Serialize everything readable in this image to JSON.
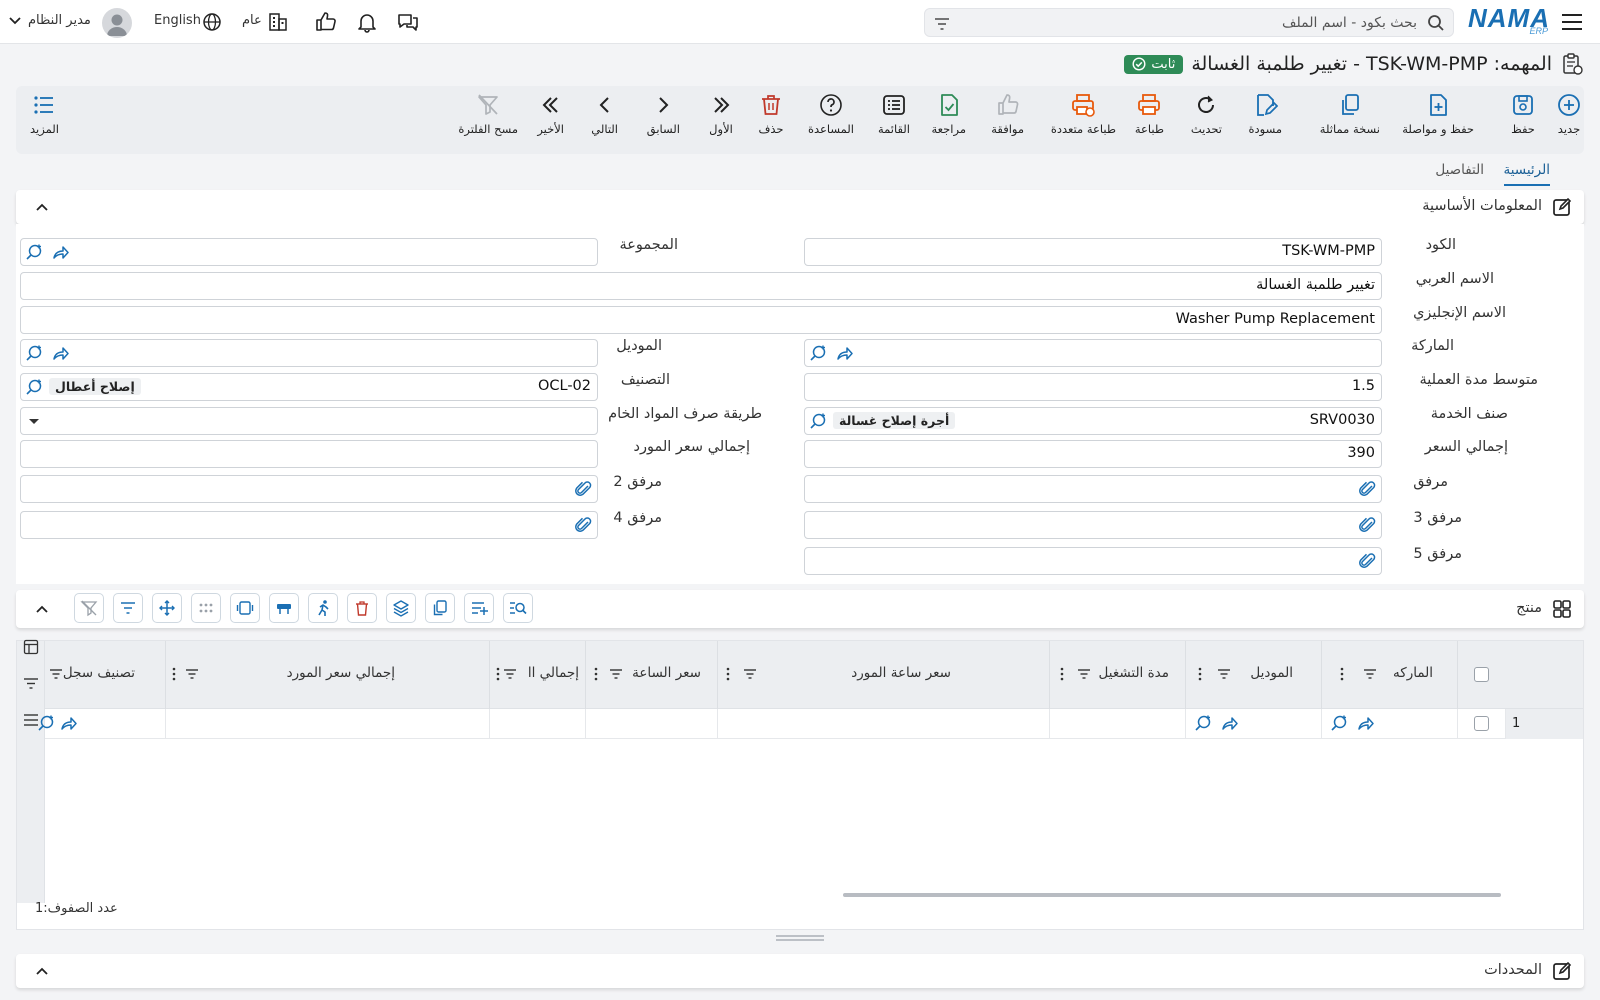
{
  "topbar": {
    "search_placeholder": "بحث بكود - اسم الملف",
    "language": "English",
    "branch": "عام",
    "user": "مدير النظام"
  },
  "title": {
    "text": "المهمه: TSK-WM-PMP - تغيير طلمبة الغسالة",
    "status": "ثابت",
    "status_color": "#2e8b57"
  },
  "actions": {
    "new": "جديد",
    "save": "حفظ",
    "save_continue": "حفظ و مواصلة",
    "duplicate": "نسخة مماثلة",
    "draft": "مسودة",
    "refresh": "تحديث",
    "print": "طباعة",
    "multi_print": "طباعة متعددة",
    "approve": "موافقة",
    "review": "مراجعة",
    "list": "القائمة",
    "help": "المساعدة",
    "delete": "حذف",
    "first": "الأول",
    "previous": "السابق",
    "next": "التالي",
    "last": "الأخير",
    "clear_filter": "مسح الفلترة",
    "more": "المزيد"
  },
  "tabs": {
    "main": "الرئيسية",
    "details": "التفاصيل"
  },
  "basic_info": {
    "title": "المعلومات الأساسية",
    "code_label": "الكود",
    "code_value": "TSK-WM-PMP",
    "group_label": "المجموعة",
    "arabic_name_label": "الاسم العربي",
    "arabic_name_value": "تغيير طلمبة الغسالة",
    "english_name_label": "الاسم الإنجليزي",
    "english_name_value": "Washer Pump Replacement",
    "brand_label": "الماركة",
    "model_label": "الموديل",
    "avg_duration_label": "متوسط مدة العملية",
    "avg_duration_value": "1.5",
    "category_label": "التصنيف",
    "category_code": "OCL-02",
    "category_name": "إصلاح أعطال",
    "service_item_label": "صنف الخدمة",
    "service_item_code": "SRV0030",
    "service_item_name": "أجرة إصلاح غسالة",
    "raw_material_label": "طريقة صرف المواد الخام",
    "total_price_label": "إجمالي السعر",
    "total_price_value": "390",
    "total_supplier_price_label": "إجمالي سعر المورد",
    "attachment_label": "مرفق",
    "attachment2_label": "مرفق 2",
    "attachment3_label": "مرفق 3",
    "attachment4_label": "مرفق 4",
    "attachment5_label": "مرفق 5"
  },
  "products": {
    "title": "منتج",
    "columns": {
      "brand": "الماركه",
      "model": "الموديل",
      "run_duration": "مدة التشغيل",
      "supplier_hour_price": "سعر ساعة المورد",
      "hour_price": "سعر الساعة",
      "total": "إجمالي اا",
      "total_supplier_price": "إجمالي سعر المورد",
      "record_class": "تصنيف سجل"
    },
    "rows": [
      {
        "index": "1"
      }
    ],
    "row_count_label": "عدد الصفوف:",
    "row_count": "1"
  },
  "determinants": {
    "title": "المحددات"
  },
  "colors": {
    "accent": "#1a6fb3",
    "print_orange": "#e8590c",
    "delete_red": "#c0392b",
    "review_green": "#2e8b57",
    "disabled_gray": "#b0b4b9"
  }
}
